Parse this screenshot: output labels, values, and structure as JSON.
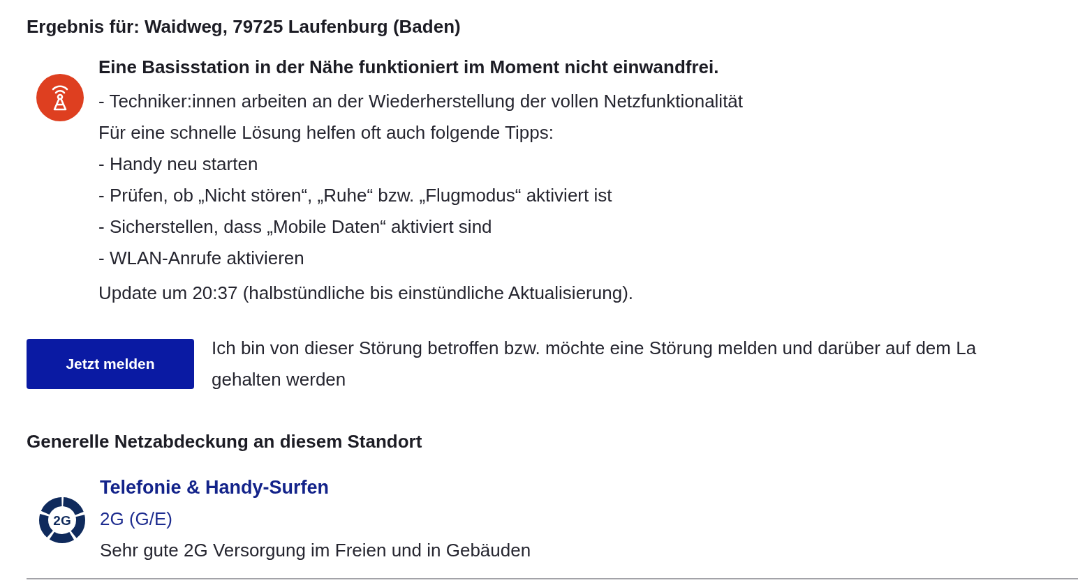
{
  "result_heading": "Ergebnis für: Waidweg, 79725 Laufenburg (Baden)",
  "outage": {
    "title": "Eine Basisstation in der Nähe funktioniert im Moment nicht einwandfrei.",
    "lines": [
      "- Techniker:innen arbeiten an der Wiederherstellung der vollen Netzfunktionalität",
      "Für eine schnelle Lösung helfen oft auch folgende Tipps:",
      "- Handy neu starten",
      "- Prüfen, ob „Nicht stören“, „Ruhe“ bzw. „Flugmodus“ aktiviert ist",
      "- Sicherstellen, dass „Mobile Daten“ aktiviert sind",
      "- WLAN-Anrufe aktivieren"
    ],
    "update": "Update um 20:37 (halbstündliche bis einstündliche Aktualisierung)."
  },
  "report": {
    "button": "Jetzt melden",
    "text_lines": [
      "Ich bin von dieser Störung betroffen bzw. möchte eine Störung melden und darüber auf dem La",
      "gehalten werden"
    ]
  },
  "coverage": {
    "heading": "Generelle Netzabdeckung an diesem Standort",
    "items": [
      {
        "badge": "2G",
        "title": "Telefonie & Handy-Surfen",
        "technology": "2G (G/E)",
        "description": "Sehr gute 2G Versorgung im Freien und in Gebäuden"
      }
    ]
  }
}
